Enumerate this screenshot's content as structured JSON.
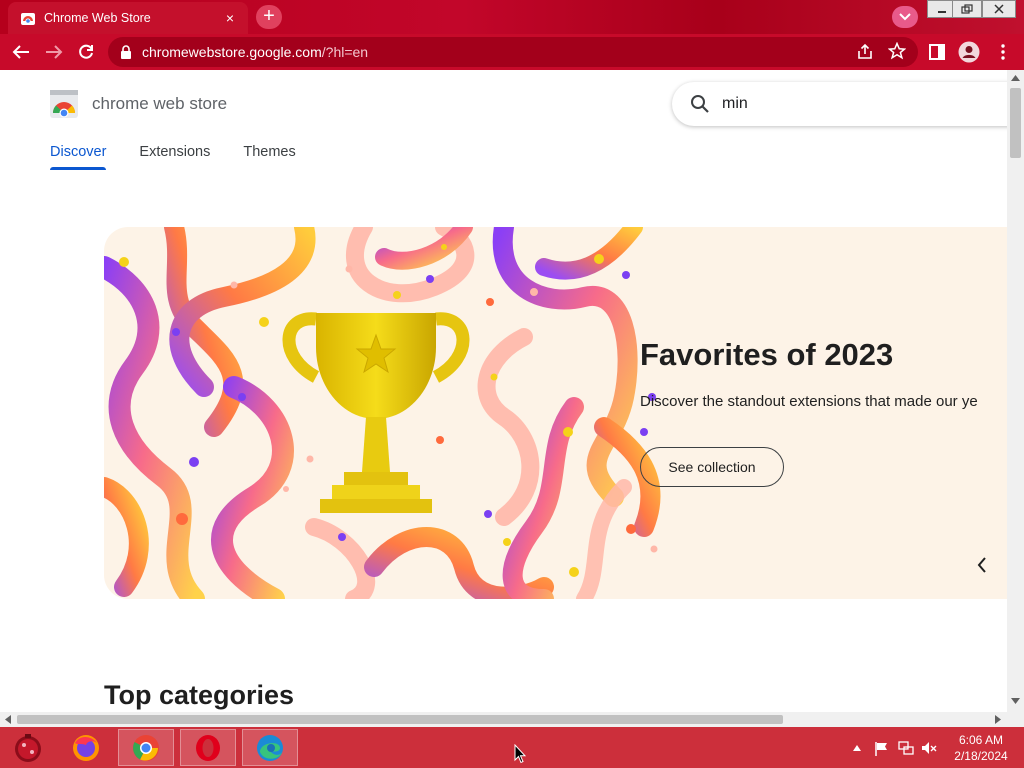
{
  "browser": {
    "tab_title": "Chrome Web Store",
    "tab_close": "×",
    "new_tab": "+",
    "url_host": "chromewebstore.google.com",
    "url_rest": "/?hl=en"
  },
  "store": {
    "brand": "chrome web store",
    "search_query": "min",
    "nav_tabs": [
      "Discover",
      "Extensions",
      "Themes"
    ],
    "active_tab": "Discover"
  },
  "hero": {
    "title": "Favorites of 2023",
    "subtitle": "Discover the standout extensions that made our ye",
    "button_label": "See collection"
  },
  "sections": {
    "top_categories": "Top categories"
  },
  "taskbar": {
    "clock_time": "6:06 AM",
    "clock_date": "2/18/2024"
  },
  "colors": {
    "chrome_red": "#c70a2a",
    "accent_blue": "#0b57d0",
    "hero_bg": "#fdf3e7",
    "taskbar": "#cc2f3b"
  },
  "icons": [
    "chrome-favicon",
    "close-icon",
    "plus-icon",
    "chevron-down-icon",
    "back-arrow-icon",
    "forward-arrow-icon",
    "reload-icon",
    "lock-icon",
    "share-icon",
    "star-icon",
    "side-panel-icon",
    "profile-icon",
    "kebab-menu-icon",
    "search-icon",
    "chevron-left-icon"
  ]
}
